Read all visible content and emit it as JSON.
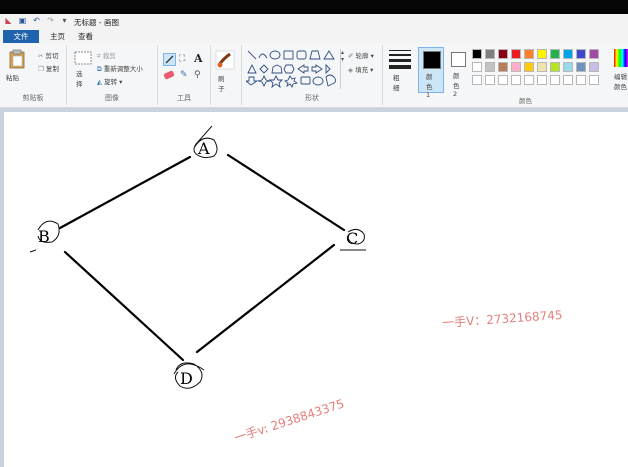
{
  "window": {
    "title": "无标题 - 画图"
  },
  "tabs": {
    "file": "文件",
    "home": "主页",
    "view": "查看"
  },
  "clipboard": {
    "paste": "粘贴",
    "cut": "剪切",
    "copy": "复制",
    "group_label": "剪贴板"
  },
  "image": {
    "select": "选择",
    "crop": "裁剪",
    "resize": "重新调整大小",
    "rotate": "旋转",
    "group_label": "图像"
  },
  "tools": {
    "group_label": "工具",
    "text_glyph": "A"
  },
  "brushes": {
    "label": "刷子"
  },
  "shapes": {
    "outline": "轮廓",
    "fill": "填充",
    "group_label": "形状"
  },
  "size": {
    "label": "粗细"
  },
  "colors": {
    "color1": "颜色 1",
    "color2": "颜色 2",
    "edit": "编辑颜色",
    "group_label": "颜色",
    "row1": [
      "#000000",
      "#7f7f7f",
      "#880015",
      "#ed1c24",
      "#ff7f27",
      "#fff200",
      "#22b14c",
      "#00a2e8",
      "#3f48cc",
      "#a349a4"
    ],
    "row2": [
      "#ffffff",
      "#c3c3c3",
      "#b97a57",
      "#ffaec9",
      "#ffc90e",
      "#efe4b0",
      "#b5e61d",
      "#99d9ea",
      "#7092be",
      "#c8bfe7"
    ],
    "active_color1": "#000000",
    "active_color2": "#ffffff"
  },
  "drawing": {
    "nodes": [
      "A",
      "B",
      "C",
      "D"
    ]
  },
  "watermarks": {
    "right": "一手V：2732168745",
    "bottom": "一手v: 2938843375"
  }
}
